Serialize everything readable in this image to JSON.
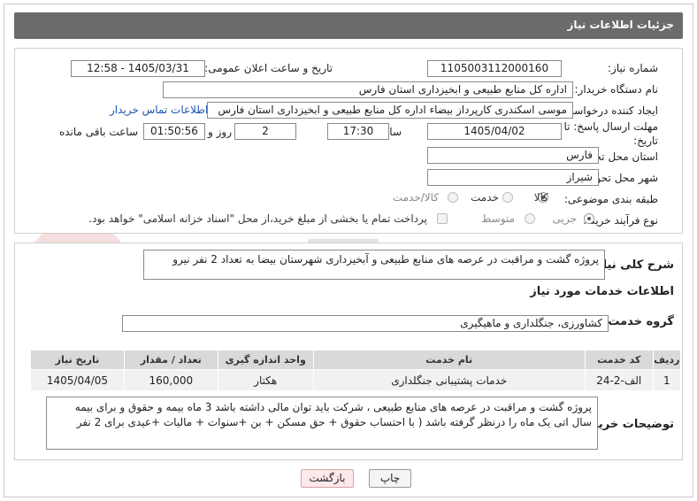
{
  "header": {
    "title": "جزئیات اطلاعات نیاز"
  },
  "fields": {
    "need_number_label": "شماره نیاز:",
    "need_number": "1105003112000160",
    "announce_label": "تاریخ و ساعت اعلان عمومی:",
    "announce_value": "1405/03/31 - 12:58",
    "buyer_org_label": "نام دستگاه خریدار:",
    "buyer_org": "اداره کل منابع طبیعی و ابخیزداری استان فارس",
    "requester_label": "ایجاد کننده درخواست:",
    "requester": "موسی اسکندری کارپرداز بیضاء اداره کل منابع طبیعی و ابخیزداری استان فارس",
    "contact_link": "اطلاعات تماس خریدار",
    "deadline_label_1": "مهلت ارسال پاسخ: تا",
    "deadline_label_2": "تاریخ:",
    "deadline_date": "1405/04/02",
    "time_label": "ساعت",
    "deadline_time": "17:30",
    "day_label": "روز و",
    "days": "2",
    "remaining_time": "01:50:56",
    "remaining_label": "ساعت باقی مانده",
    "province_label": "استان محل تحویل:",
    "province": "فارس",
    "city_label": "شهر محل تحویل:",
    "city": "شیراز",
    "category_label": "طبقه بندی موضوعی:",
    "category_options": [
      "کالا",
      "خدمت",
      "کالا/خدمت"
    ],
    "process_label": "نوع فرآیند خرید :",
    "process_options": [
      "جزیی",
      "متوسط"
    ],
    "payment_note": "پرداخت تمام یا بخشی از مبلغ خرید،از محل \"اسناد خزانه اسلامی\" خواهد بود."
  },
  "summary": {
    "label": "شرح کلی نیاز:",
    "text": "پروژه گشت و مراقبت در عرصه های منابع طبیعی و آبخیزداری شهرستان بیضا به تعداد 2 نفر نیرو"
  },
  "services": {
    "section_title": "اطلاعات خدمات مورد نیاز",
    "group_label": "گروه خدمت:",
    "group_value": "کشاورزی، جنگلداری و ماهیگیری",
    "columns": [
      "ردیف",
      "کد خدمت",
      "نام خدمت",
      "واحد اندازه گیری",
      "تعداد / مقدار",
      "تاریخ نیاز"
    ],
    "rows": [
      {
        "index": "1",
        "code": "الف-2-24",
        "name": "خدمات پشتیبانی جنگلداری",
        "unit": "هکتار",
        "qty": "160,000",
        "date": "1405/04/05"
      }
    ]
  },
  "buyer_notes": {
    "label": "توضیحات خریدار:",
    "text": "پروژه گشت و مراقبت در عرصه های منابع طبیعی ، شرکت باید توان مالی داشته باشد 3 ماه بیمه و حقوق و برای بیمه سال اتی یک ماه را درنظر گرفته باشد ( با احتساب حقوق +  حق مسکن + بن +سنوات + مالیات +عیدی برای 2 نفر"
  },
  "buttons": {
    "print": "چاپ",
    "back": "بازگشت"
  },
  "colors": {
    "header_bg": "#6b6b6b",
    "link": "#1a55b0",
    "back_button_bg": "#fde9ea",
    "table_header_bg": "#d9d9d9"
  }
}
